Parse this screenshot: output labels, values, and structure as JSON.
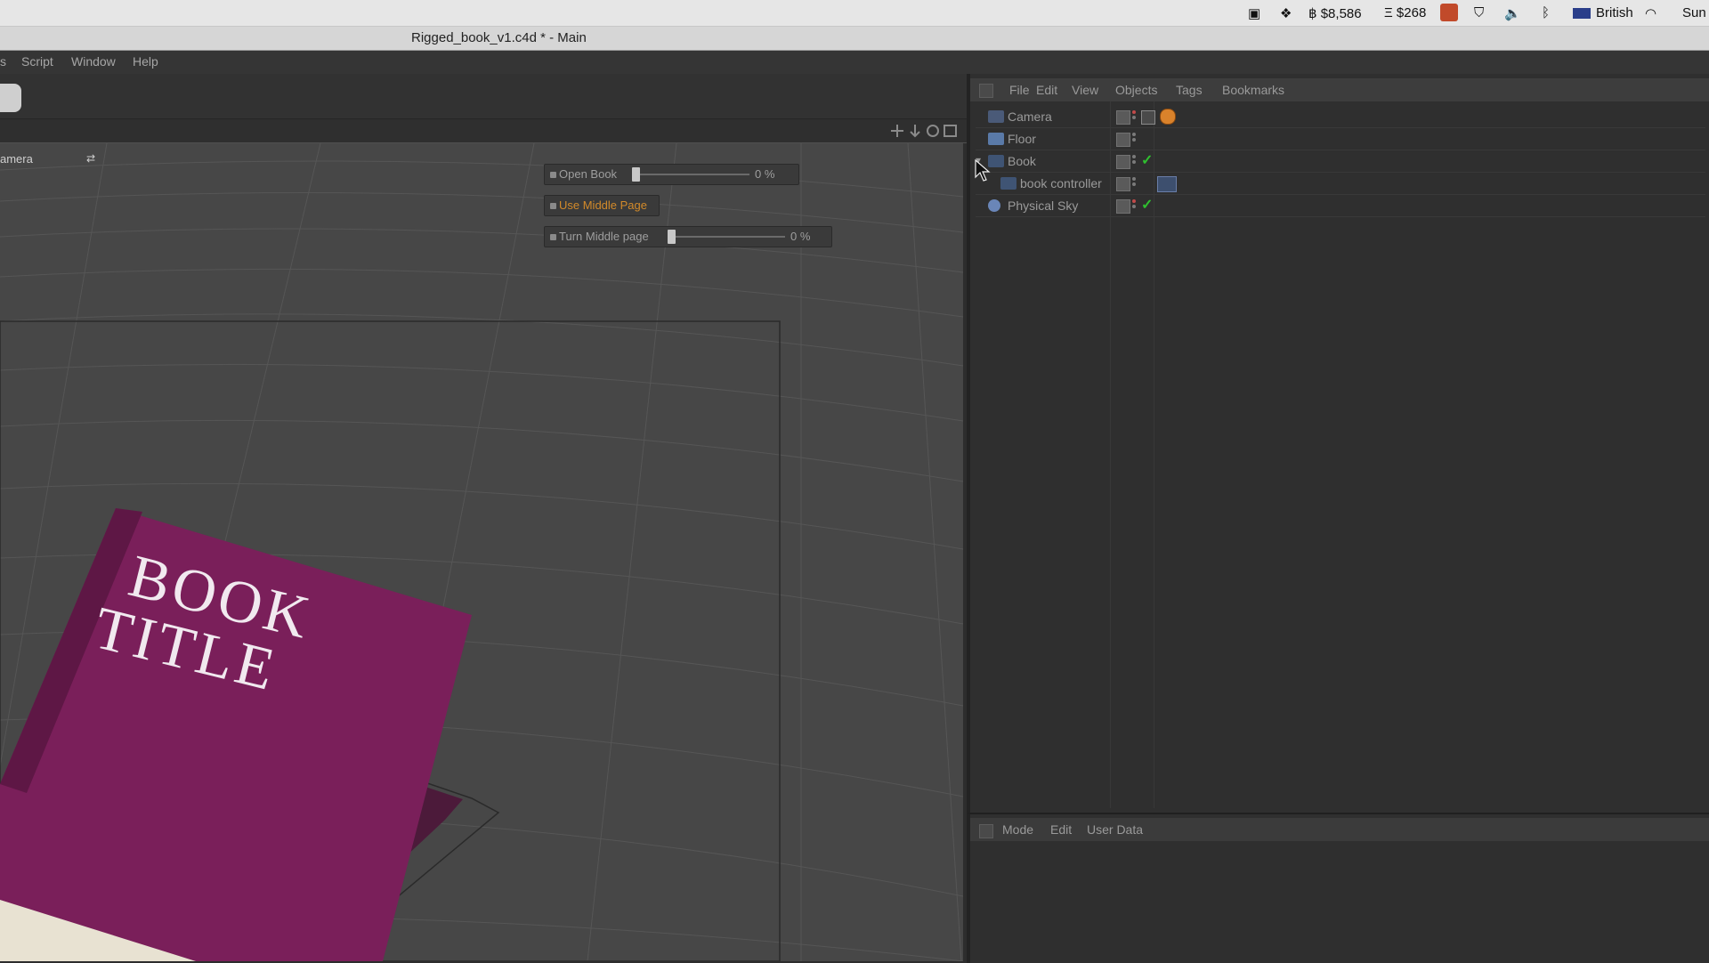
{
  "window_title": "Rigged_book_v1.c4d * - Main",
  "system_bar": {
    "btc": "฿ $8,586",
    "eth": "Ξ $268",
    "language": "British",
    "clock": "Sun"
  },
  "app_menu": [
    "s",
    "Script",
    "Window",
    "Help"
  ],
  "viewport": {
    "camera_label": "amera",
    "book_cover_line1": "BOOK",
    "book_cover_line2": "TITLE",
    "controls": [
      {
        "label": "Open Book",
        "value": "0 %",
        "level": 0
      },
      {
        "label": "Use Middle Page"
      },
      {
        "label": "Turn Middle page",
        "value": "0 %",
        "level": 0
      }
    ]
  },
  "object_manager": {
    "menu": [
      "File",
      "Edit",
      "View",
      "Objects",
      "Tags",
      "Bookmarks"
    ],
    "objects": [
      {
        "name": "Camera",
        "icon": "camera-icon"
      },
      {
        "name": "Floor",
        "icon": "floor-icon"
      },
      {
        "name": "Book",
        "icon": "null-object-icon"
      },
      {
        "name": "book controller",
        "icon": "null-object-icon"
      },
      {
        "name": "Physical Sky",
        "icon": "sky-icon"
      }
    ]
  },
  "attribute_manager": {
    "menu": [
      "Mode",
      "Edit",
      "User Data"
    ]
  },
  "colors": {
    "book_cover": "#7a1f5a",
    "accent_orange": "#d28a2a",
    "check_green": "#2fbf2f"
  }
}
